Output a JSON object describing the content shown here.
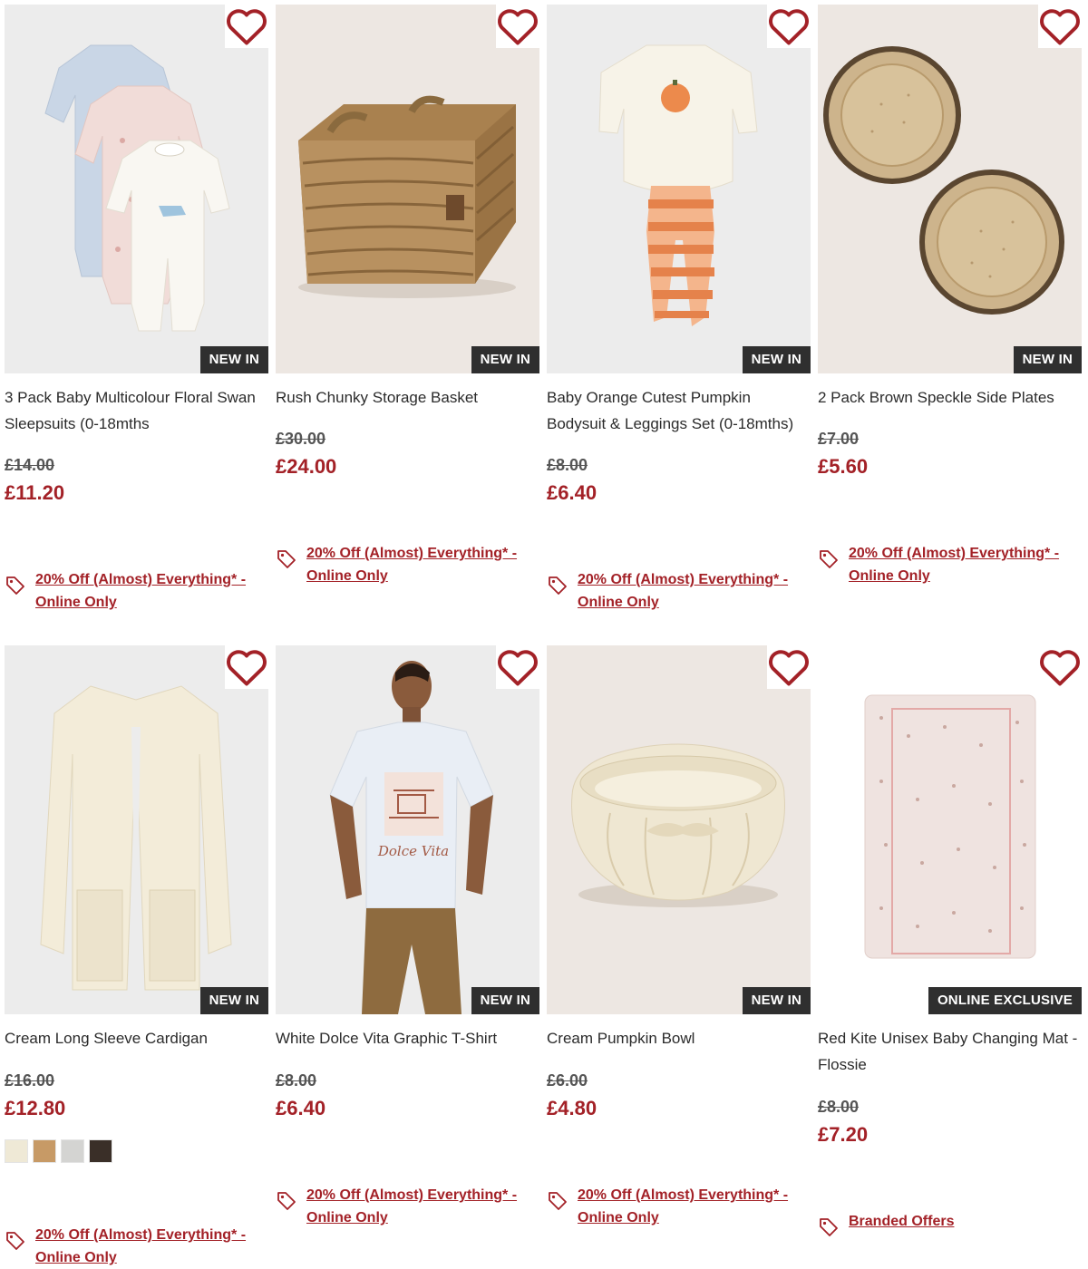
{
  "products": [
    {
      "title": "3 Pack Baby Multicolour Floral Swan Sleepsuits (0-18mths",
      "was_price": "£14.00",
      "now_price": "£11.20",
      "badge": "NEW IN",
      "promo": "20% Off (Almost) Everything* - Online Only"
    },
    {
      "title": "Rush Chunky Storage Basket",
      "was_price": "£30.00",
      "now_price": "£24.00",
      "badge": "NEW IN",
      "promo": "20% Off (Almost) Everything* - Online Only"
    },
    {
      "title": "Baby Orange Cutest Pumpkin Bodysuit & Leggings Set (0-18mths)",
      "was_price": "£8.00",
      "now_price": "£6.40",
      "badge": "NEW IN",
      "promo": "20% Off (Almost) Everything* - Online Only"
    },
    {
      "title": "2 Pack Brown Speckle Side Plates",
      "was_price": "£7.00",
      "now_price": "£5.60",
      "badge": "NEW IN",
      "promo": "20% Off (Almost) Everything* - Online Only"
    },
    {
      "title": "Cream Long Sleeve Cardigan",
      "was_price": "£16.00",
      "now_price": "£12.80",
      "badge": "NEW IN",
      "promo": "20% Off (Almost) Everything* - Online Only",
      "swatches": [
        "#efe9d6",
        "#c79a66",
        "#d4d4d2",
        "#3a2f28"
      ]
    },
    {
      "title": "White Dolce Vita Graphic T-Shirt",
      "was_price": "£8.00",
      "now_price": "£6.40",
      "badge": "NEW IN",
      "promo": "20% Off (Almost) Everything* - Online Only"
    },
    {
      "title": "Cream Pumpkin Bowl",
      "was_price": "£6.00",
      "now_price": "£4.80",
      "badge": "NEW IN",
      "promo": "20% Off (Almost) Everything* - Online Only"
    },
    {
      "title": "Red Kite Unisex Baby Changing Mat - Flossie",
      "was_price": "£8.00",
      "now_price": "£7.20",
      "badge": "ONLINE EXCLUSIVE",
      "promo": "Branded Offers"
    }
  ],
  "print_text": {
    "tshirt_script": "Dolce Vita"
  },
  "icons": {
    "wishlist": "heart-outline-icon",
    "promo": "price-tag-icon"
  },
  "colors": {
    "accent": "#a32127",
    "badge_bg": "#2f2f2f"
  }
}
